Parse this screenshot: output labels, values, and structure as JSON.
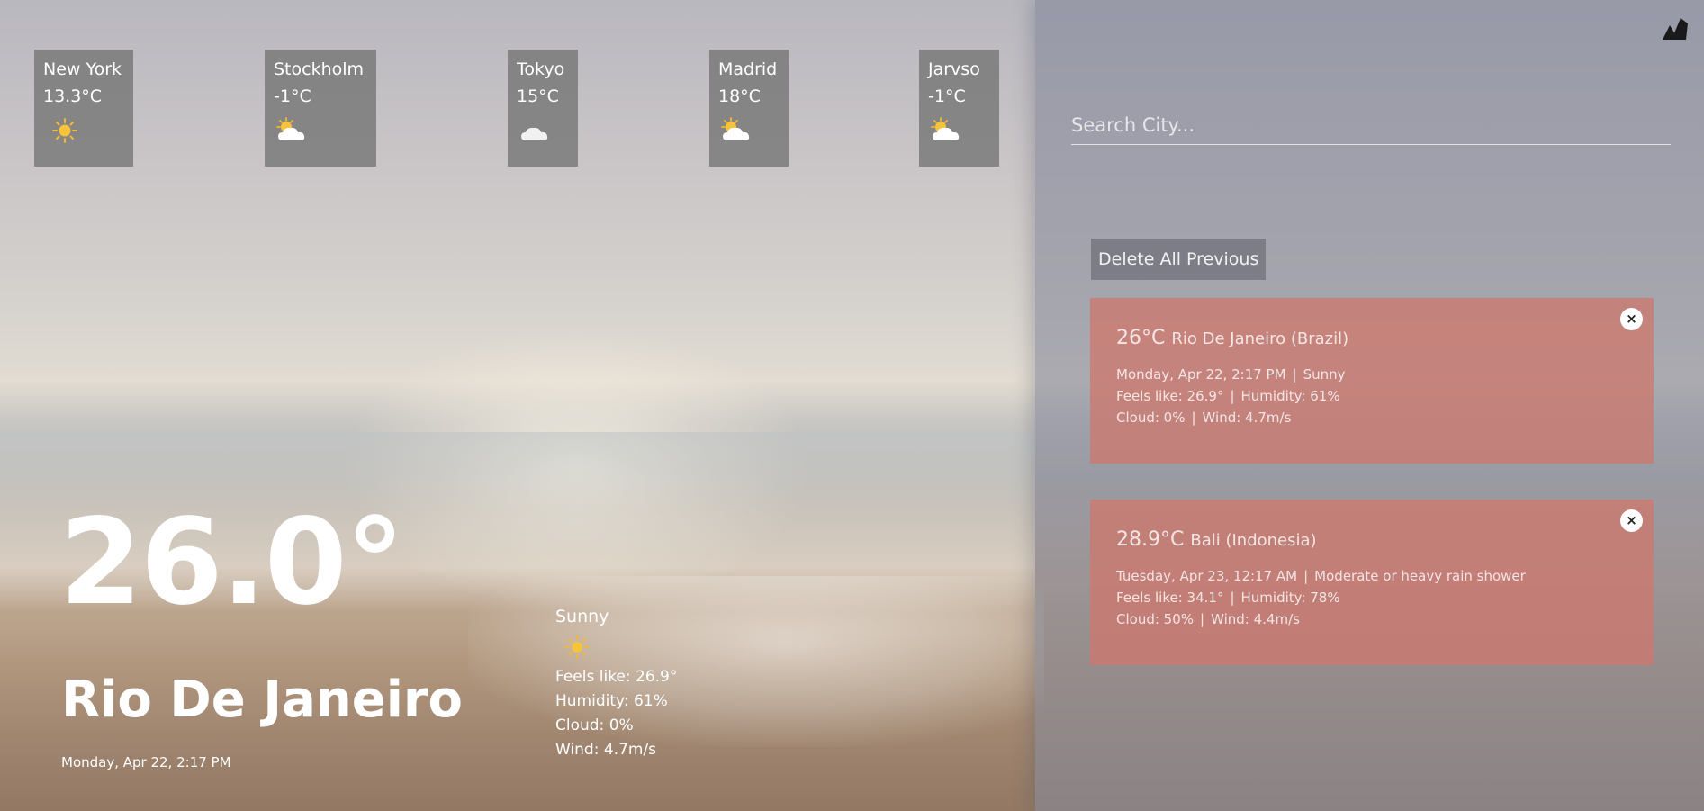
{
  "top_cities": [
    {
      "name": "New York",
      "temp": "13.3°C",
      "icon": "sun-icon"
    },
    {
      "name": "Stockholm",
      "temp": "-1°C",
      "icon": "partly-cloudy-icon"
    },
    {
      "name": "Tokyo",
      "temp": "15°C",
      "icon": "cloud-icon"
    },
    {
      "name": "Madrid",
      "temp": "18°C",
      "icon": "partly-cloudy-icon"
    },
    {
      "name": "Jarvso",
      "temp": "-1°C",
      "icon": "partly-cloudy-icon"
    }
  ],
  "current": {
    "temp": "26.0°",
    "city": "Rio De Janeiro",
    "date": "Monday, Apr 22, 2:17 PM",
    "condition": "Sunny",
    "condition_icon": "sun-icon",
    "feels_like": "Feels like: 26.9°",
    "humidity": "Humidity: 61%",
    "cloud": "Cloud: 0%",
    "wind": "Wind: 4.7m/s"
  },
  "sidebar": {
    "search_placeholder": "Search City...",
    "delete_label": "Delete All Previous",
    "close_label": "×",
    "history": [
      {
        "temp": "26°C",
        "location": "Rio De Janeiro (Brazil)",
        "date": "Monday, Apr 22, 2:17 PM",
        "condition": "Sunny",
        "feels_like": "Feels like: 26.9°",
        "humidity": "Humidity: 61%",
        "cloud": "Cloud: 0%",
        "wind": "Wind: 4.7m/s"
      },
      {
        "temp": "28.9°C",
        "location": "Bali (Indonesia)",
        "date": "Tuesday, Apr 23, 12:17 AM",
        "condition": "Moderate or heavy rain shower",
        "feels_like": "Feels like: 34.1°",
        "humidity": "Humidity: 78%",
        "cloud": "Cloud: 50%",
        "wind": "Wind: 4.4m/s"
      }
    ],
    "separator": "|"
  },
  "colors": {
    "card_bg": "#6e6e6e",
    "history_bg": "#cd786e",
    "sidebar_bg": "#7d8296",
    "sun": "#f5b82e"
  }
}
